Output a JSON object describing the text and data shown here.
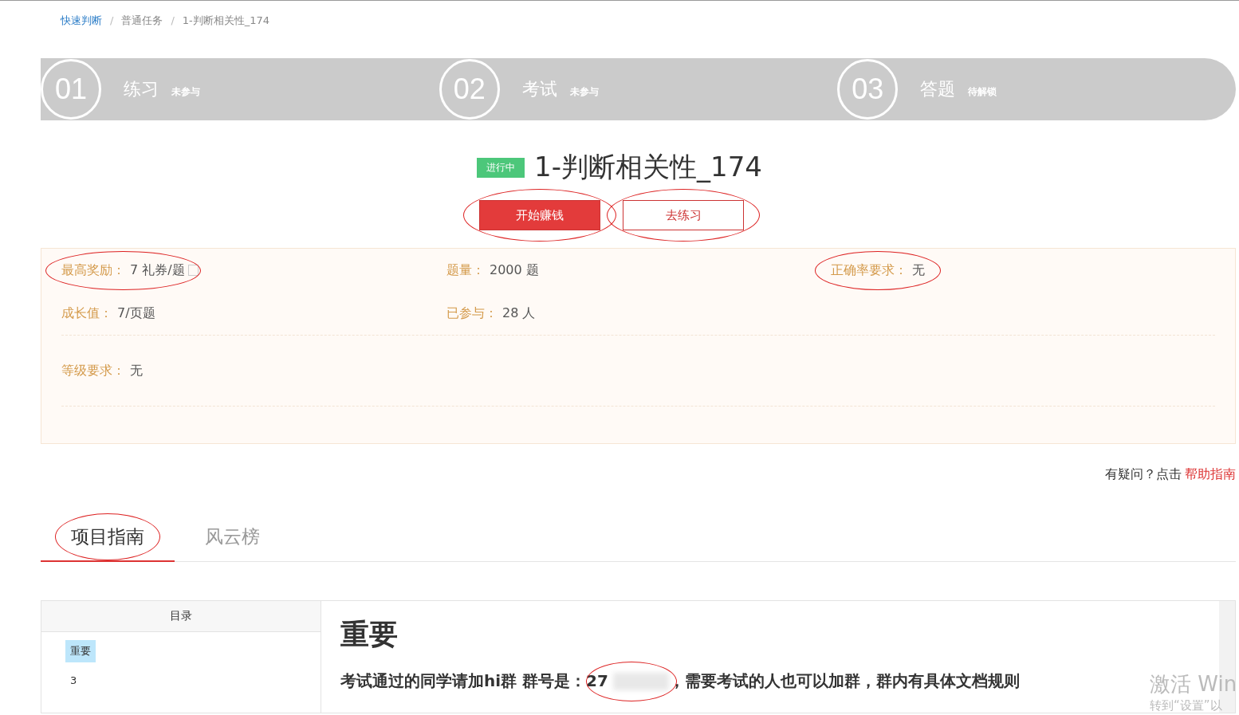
{
  "breadcrumb": [
    {
      "label": "快速判断",
      "link": true
    },
    {
      "label": "普通任务",
      "link": false
    },
    {
      "label": "1-判断相关性_174",
      "link": false
    }
  ],
  "breadcrumb_separator": "/",
  "steps": [
    {
      "number": "01",
      "label": "练习",
      "status": "未参与"
    },
    {
      "number": "02",
      "label": "考试",
      "status": "未参与"
    },
    {
      "number": "03",
      "label": "答题",
      "status": "待解锁"
    }
  ],
  "task": {
    "badge": "进行中",
    "title": "1-判断相关性_174"
  },
  "buttons": [
    {
      "label": "开始赚钱",
      "kind": "primary",
      "circled": true
    },
    {
      "label": "去练习",
      "kind": "outline",
      "circled": true
    }
  ],
  "info_rows": [
    [
      {
        "label": "最高奖励：",
        "value": "7 礼券/题",
        "help": true,
        "circled": true
      },
      {
        "label": "题量：",
        "value": "2000 题"
      },
      {
        "label": "正确率要求：",
        "value": "无",
        "circled": true
      }
    ],
    [
      {
        "label": "成长值：",
        "value": "7/页题"
      },
      {
        "label": "已参与：",
        "value": "28 人"
      }
    ],
    [
      {
        "label": "等级要求：",
        "value": "无"
      }
    ]
  ],
  "help_line": {
    "text": "有疑问？点击",
    "link": "帮助指南"
  },
  "tabs": [
    {
      "label": "项目指南",
      "selected": true,
      "circled": true
    },
    {
      "label": "风云榜",
      "selected": false
    }
  ],
  "toc": {
    "title": "目录",
    "items": [
      {
        "label": "重要",
        "selected": true
      },
      {
        "label": "3",
        "selected": false
      }
    ]
  },
  "article": {
    "heading": "重要",
    "text_before": "考试通过的同学请加hi群  群号是：27",
    "text_after": "，需要考试的人也可以加群，群内有具体文档规则"
  },
  "os_overlay": {
    "line_1": "激活 Win",
    "line_2": "转到“设置”以"
  }
}
